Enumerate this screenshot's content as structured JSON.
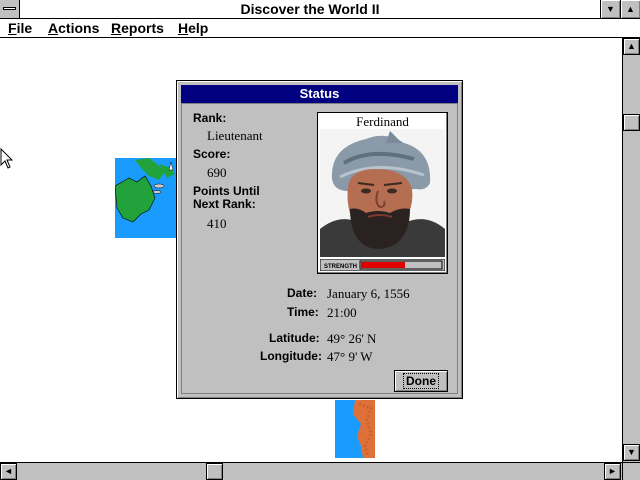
{
  "window": {
    "title": "Discover the World II",
    "min_glyph": "▼",
    "max_glyph": "▲"
  },
  "menu": [
    {
      "label": "File",
      "accel": "F",
      "rest": "ile"
    },
    {
      "label": "Actions",
      "accel": "A",
      "rest": "ctions"
    },
    {
      "label": "Reports",
      "accel": "R",
      "rest": "eports"
    },
    {
      "label": "Help",
      "accel": "H",
      "rest": "elp"
    }
  ],
  "dialog": {
    "title": "Status",
    "rank_label": "Rank:",
    "rank_value": "Lieutenant",
    "score_label": "Score:",
    "score_value": "690",
    "next_label_1": "Points Until",
    "next_label_2": "Next Rank:",
    "next_value": "410",
    "portrait_name": "Ferdinand",
    "strength_label": "STRENGTH",
    "strength_fraction": 0.55,
    "date_label": "Date:",
    "date_value": "January 6, 1556",
    "time_label": "Time:",
    "time_value": "21:00",
    "latitude_label": "Latitude:",
    "latitude_value": "49° 26' N",
    "longitude_label": "Longitude:",
    "longitude_value": "47° 9' W",
    "done_label": "Done"
  },
  "scroll": {
    "up_glyph": "▲",
    "down_glyph": "▼",
    "left_glyph": "◄",
    "right_glyph": "►"
  }
}
